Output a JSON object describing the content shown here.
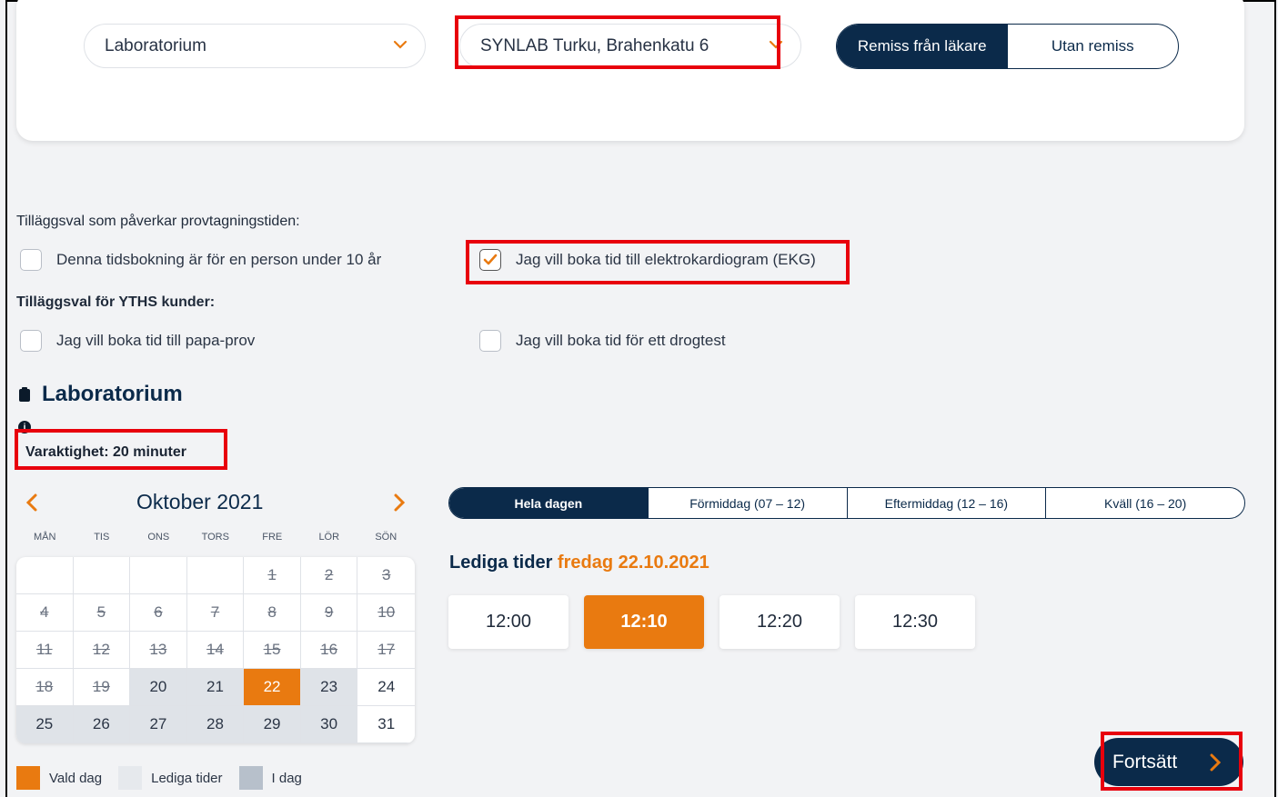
{
  "filters": {
    "service": "Laboratorium",
    "location": "SYNLAB Turku, Brahenkatu 6",
    "referral_options": [
      "Remiss från läkare",
      "Utan remiss"
    ]
  },
  "options": {
    "heading": "Tilläggsval som påverkar provtagningstiden:",
    "under_10": "Denna tidsbokning är för en person under 10 år",
    "ekg": "Jag vill boka tid till elektrokardiogram (EKG)",
    "yths_heading": "Tilläggsval för YTHS kunder:",
    "papa": "Jag vill boka tid till papa-prov",
    "drug_test": "Jag vill boka tid för ett drogtest"
  },
  "lab": {
    "title": "Laboratorium",
    "info": "i",
    "duration": "Varaktighet: 20 minuter"
  },
  "calendar": {
    "month": "Oktober 2021",
    "weekdays": [
      "MÅN",
      "TIS",
      "ONS",
      "TORS",
      "FRE",
      "LÖR",
      "SÖN"
    ],
    "days": [
      "",
      "",
      "",
      "",
      "1",
      "2",
      "3",
      "4",
      "5",
      "6",
      "7",
      "8",
      "9",
      "10",
      "11",
      "12",
      "13",
      "14",
      "15",
      "16",
      "17",
      "18",
      "19",
      "20",
      "21",
      "22",
      "23",
      "24",
      "25",
      "26",
      "27",
      "28",
      "29",
      "30",
      "31"
    ]
  },
  "legend": [
    "Vald dag",
    "Lediga tider",
    "I dag"
  ],
  "time_tabs": [
    "Hela dagen",
    "Förmiddag (07 – 12)",
    "Eftermiddag (12 – 16)",
    "Kväll  (16 – 20)"
  ],
  "slots_heading": {
    "label": "Lediga tider",
    "date": "fredag 22.10.2021"
  },
  "slots": [
    "12:00",
    "12:10",
    "12:20",
    "12:30"
  ],
  "continue_label": "Fortsätt",
  "colors": {
    "navy": "#0b2a4a",
    "orange": "#e97a10",
    "highlight": "#e8000c"
  }
}
